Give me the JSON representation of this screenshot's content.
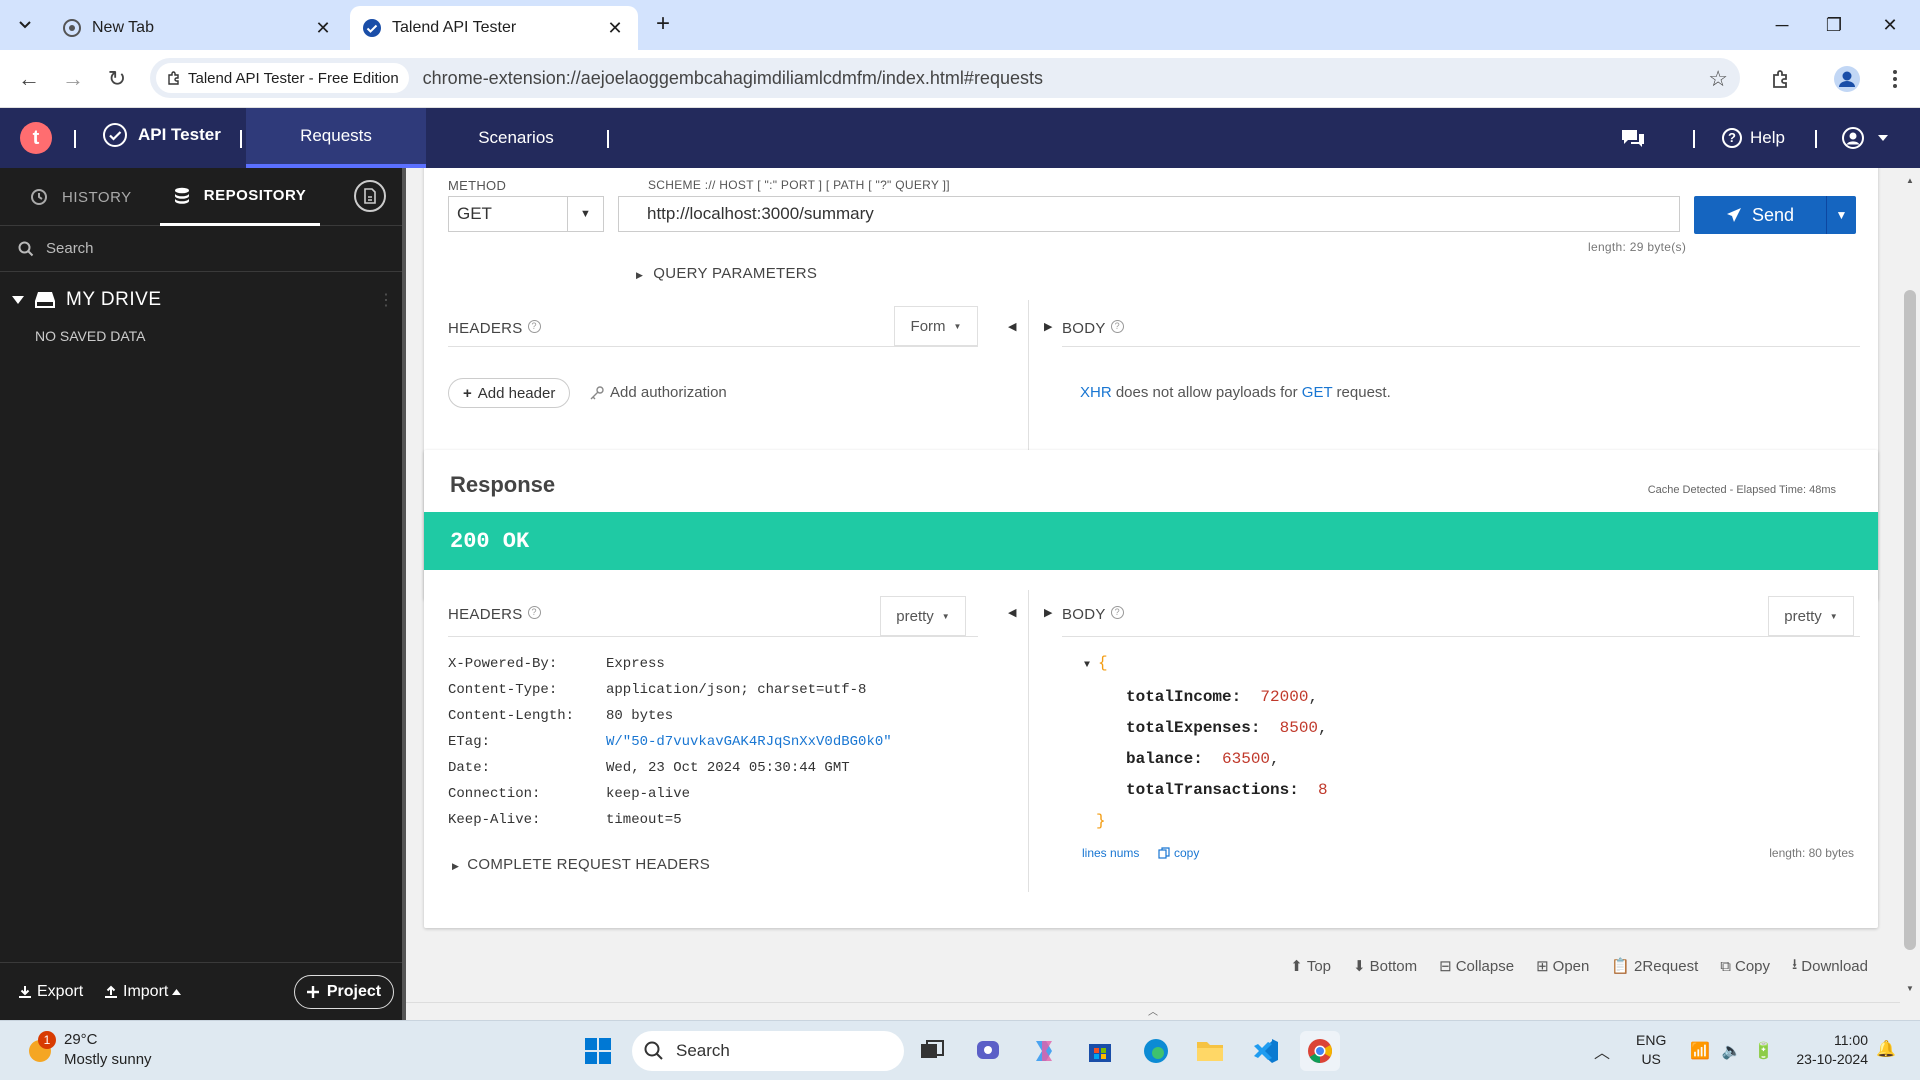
{
  "browser": {
    "tabs": [
      {
        "title": "New Tab"
      },
      {
        "title": "Talend API Tester"
      }
    ],
    "site_chip": "Talend API Tester - Free Edition",
    "url": "chrome-extension://aejoelaoggembcahagimdiliamlcdmfm/index.html#requests"
  },
  "app": {
    "logo_letter": "t",
    "name": "API Tester",
    "nav": [
      "Requests",
      "Scenarios"
    ],
    "help": "Help"
  },
  "sidebar": {
    "tabs": [
      "HISTORY",
      "REPOSITORY"
    ],
    "search_placeholder": "Search",
    "drive_title": "MY DRIVE",
    "empty": "NO SAVED DATA",
    "export": "Export",
    "import": "Import",
    "project": "Project"
  },
  "request": {
    "method_label": "METHOD",
    "method": "GET",
    "scheme_label": "SCHEME :// HOST [ \":\" PORT ] [ PATH [ \"?\" QUERY ]]",
    "url": "http://localhost:3000/summary",
    "length": "length: 29 byte(s)",
    "send": "Send",
    "query_params": "QUERY PARAMETERS",
    "headers_label": "HEADERS",
    "headers_mode": "Form",
    "body_label": "BODY",
    "add_header": "Add header",
    "add_auth": "Add authorization",
    "body_note_1": "XHR",
    "body_note_2": " does not allow payloads for ",
    "body_note_3": "GET",
    "body_note_4": " request."
  },
  "response": {
    "title": "Response",
    "cache_info": "Cache Detected - Elapsed Time: 48ms",
    "status": "200 OK",
    "headers_label": "HEADERS",
    "headers_mode": "pretty",
    "body_label": "BODY",
    "body_mode": "pretty",
    "headers": [
      {
        "k": "X-Powered-By:",
        "v": "Express"
      },
      {
        "k": "Content-Type:",
        "v": "application/json; charset=utf-8"
      },
      {
        "k": "Content-Length:",
        "v": "80 bytes"
      },
      {
        "k": "ETag:",
        "v": "W/\"50-d7vuvkavGAK4RJqSnXxV0dBG0k0\""
      },
      {
        "k": "Date:",
        "v": "Wed, 23 Oct 2024 05:30:44 GMT"
      },
      {
        "k": "Connection:",
        "v": "keep-alive"
      },
      {
        "k": "Keep-Alive:",
        "v": "timeout=5"
      }
    ],
    "complete_headers": "COMPLETE REQUEST HEADERS",
    "json_open": "{",
    "json_close": "}",
    "json": [
      {
        "key": "totalIncome:",
        "val": "72000",
        "sep": ","
      },
      {
        "key": "totalExpenses:",
        "val": "8500",
        "sep": ","
      },
      {
        "key": "balance:",
        "val": "63500",
        "sep": ","
      },
      {
        "key": "totalTransactions:",
        "val": "8",
        "sep": ""
      }
    ],
    "lines_nums": "lines nums",
    "copy": "copy",
    "body_length": "length: 80 bytes"
  },
  "footer_actions": [
    "Top",
    "Bottom",
    "Collapse",
    "Open",
    "2Request",
    "Copy",
    "Download"
  ],
  "taskbar": {
    "temp": "29°C",
    "weather": "Mostly sunny",
    "badge": "1",
    "search": "Search",
    "lang1": "ENG",
    "lang2": "US",
    "time": "11:00",
    "date": "23-10-2024"
  },
  "colors": {
    "app_header": "#232a5c",
    "status_ok": "#1fcaa4",
    "send_button": "#1565c0",
    "link": "#1976d2"
  }
}
